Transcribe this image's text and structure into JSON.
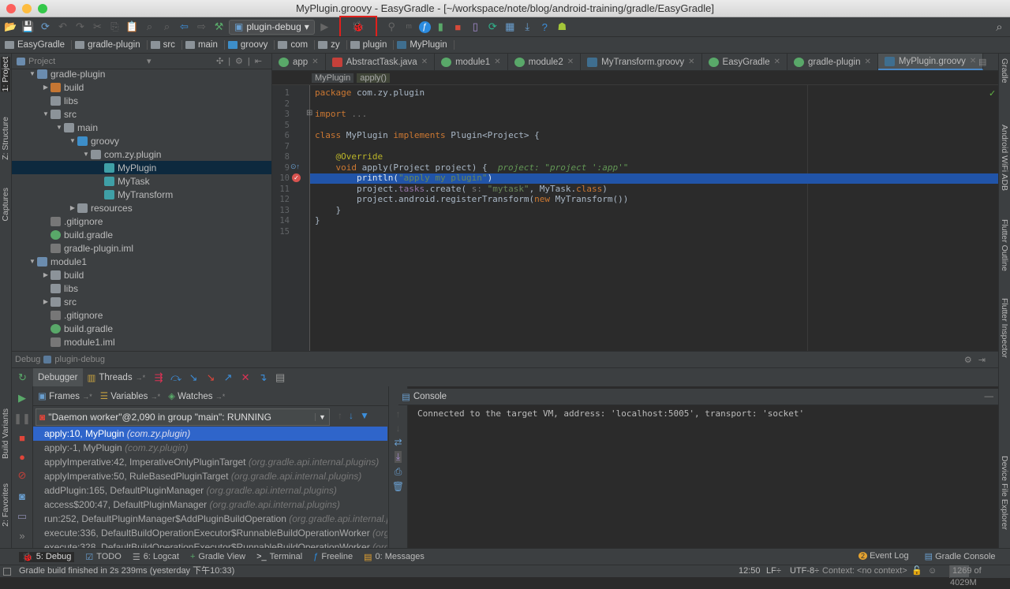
{
  "window": {
    "title": "MyPlugin.groovy - EasyGradle - [~/workspace/note/blog/android-training/gradle/EasyGradle]"
  },
  "toolbar": {
    "run_config": "plugin-debug",
    "icons": [
      "open-icon",
      "save-icon",
      "sync-icon",
      "undo-icon",
      "redo-icon",
      "cut-icon",
      "copy-icon",
      "paste-icon",
      "find-icon",
      "replace-icon",
      "back-icon",
      "forward-icon",
      "build-hammer-icon"
    ],
    "icons_right": [
      "run-icon",
      "debug-icon",
      "attach-icon",
      "profile-icon",
      "freeline-icon",
      "apply-changes-icon",
      "stop-icon",
      "avd-manager-icon",
      "gradle-sync-icon",
      "project-structure-icon",
      "sdk-manager-icon",
      "help-icon",
      "android-icon"
    ],
    "highlight_color": "#e0201c"
  },
  "breadcrumb": [
    "EasyGradle",
    "gradle-plugin",
    "src",
    "main",
    "groovy",
    "com",
    "zy",
    "plugin",
    "MyPlugin"
  ],
  "left_strip": [
    "1: Project",
    "Z: Structure",
    "Captures",
    "Build Variants",
    "2: Favorites"
  ],
  "right_strip": [
    "Gradle",
    "Android WiFi ADB",
    "Flutter Outline",
    "Flutter Inspector",
    "Device File Explorer"
  ],
  "project": {
    "header": "Project",
    "tree": [
      {
        "label": "gradle-plugin",
        "depth": 0,
        "arrow": "open",
        "type": "module"
      },
      {
        "label": "build",
        "depth": 1,
        "arrow": "closed",
        "type": "folder-orange"
      },
      {
        "label": "libs",
        "depth": 1,
        "arrow": "",
        "type": "folder"
      },
      {
        "label": "src",
        "depth": 1,
        "arrow": "open",
        "type": "folder"
      },
      {
        "label": "main",
        "depth": 2,
        "arrow": "open",
        "type": "folder"
      },
      {
        "label": "groovy",
        "depth": 3,
        "arrow": "open",
        "type": "folder-blue"
      },
      {
        "label": "com.zy.plugin",
        "depth": 4,
        "arrow": "open",
        "type": "package"
      },
      {
        "label": "MyPlugin",
        "depth": 5,
        "arrow": "",
        "type": "groovy",
        "selected": true
      },
      {
        "label": "MyTask",
        "depth": 5,
        "arrow": "",
        "type": "groovy"
      },
      {
        "label": "MyTransform",
        "depth": 5,
        "arrow": "",
        "type": "groovy"
      },
      {
        "label": "resources",
        "depth": 3,
        "arrow": "closed",
        "type": "folder"
      },
      {
        "label": ".gitignore",
        "depth": 1,
        "arrow": "",
        "type": "file"
      },
      {
        "label": "build.gradle",
        "depth": 1,
        "arrow": "",
        "type": "gradle"
      },
      {
        "label": "gradle-plugin.iml",
        "depth": 1,
        "arrow": "",
        "type": "file"
      },
      {
        "label": "module1",
        "depth": 0,
        "arrow": "open",
        "type": "module"
      },
      {
        "label": "build",
        "depth": 1,
        "arrow": "closed",
        "type": "folder"
      },
      {
        "label": "libs",
        "depth": 1,
        "arrow": "",
        "type": "folder"
      },
      {
        "label": "src",
        "depth": 1,
        "arrow": "closed",
        "type": "folder"
      },
      {
        "label": ".gitignore",
        "depth": 1,
        "arrow": "",
        "type": "file"
      },
      {
        "label": "build.gradle",
        "depth": 1,
        "arrow": "",
        "type": "gradle"
      },
      {
        "label": "module1.iml",
        "depth": 1,
        "arrow": "",
        "type": "file"
      }
    ]
  },
  "editor": {
    "tabs": [
      {
        "label": "app",
        "icon": "gradle"
      },
      {
        "label": "AbstractTask.java",
        "icon": "java"
      },
      {
        "label": "module1",
        "icon": "gradle"
      },
      {
        "label": "module2",
        "icon": "gradle"
      },
      {
        "label": "MyTransform.groovy",
        "icon": "groovy"
      },
      {
        "label": "EasyGradle",
        "icon": "gradle"
      },
      {
        "label": "gradle-plugin",
        "icon": "gradle"
      },
      {
        "label": "MyPlugin.groovy",
        "icon": "groovy",
        "active": true
      }
    ],
    "code_breadcrumb": [
      "MyPlugin",
      "apply()"
    ],
    "lines": [
      {
        "n": "1",
        "t": [
          [
            "package",
            "k"
          ],
          [
            " com.zy.plugin",
            ""
          ]
        ]
      },
      {
        "n": "2",
        "t": []
      },
      {
        "n": "3",
        "t": [
          [
            "import",
            "k"
          ],
          [
            " ...",
            "h"
          ]
        ]
      },
      {
        "n": "5",
        "t": []
      },
      {
        "n": "6",
        "t": [
          [
            "class",
            "k"
          ],
          [
            " MyPlugin ",
            ""
          ],
          [
            "implements",
            "k"
          ],
          [
            " Plugin<Project> {",
            ""
          ]
        ]
      },
      {
        "n": "7",
        "t": []
      },
      {
        "n": "8",
        "t": [
          [
            "    @Override",
            "a"
          ]
        ]
      },
      {
        "n": "9",
        "t": [
          [
            "    ",
            ""
          ],
          [
            "void",
            "k"
          ],
          [
            " apply(Project project) {  ",
            ""
          ],
          [
            "project: \"project ':app'\"",
            "p"
          ]
        ]
      },
      {
        "n": "10",
        "t": [
          [
            "        println(",
            ""
          ],
          [
            "\"apply my plugin\"",
            "s"
          ],
          [
            ")",
            ""
          ]
        ],
        "current": true
      },
      {
        "n": "11",
        "t": [
          [
            "        project.",
            ""
          ],
          [
            "tasks",
            "f"
          ],
          [
            ".create( ",
            ""
          ],
          [
            "s: ",
            "h"
          ],
          [
            "\"mytask\"",
            "s"
          ],
          [
            ", MyTask.",
            ""
          ],
          [
            "class",
            "k"
          ],
          [
            ")",
            ""
          ]
        ]
      },
      {
        "n": "12",
        "t": [
          [
            "        project.android.registerTransform(",
            ""
          ],
          [
            "new",
            "k"
          ],
          [
            " MyTransform())",
            ""
          ]
        ]
      },
      {
        "n": "13",
        "t": [
          [
            "    }",
            ""
          ]
        ]
      },
      {
        "n": "14",
        "t": [
          [
            "}",
            ""
          ]
        ]
      },
      {
        "n": "15",
        "t": []
      }
    ]
  },
  "debug": {
    "title": "Debug",
    "config": "plugin-debug",
    "tabs": {
      "debugger": "Debugger",
      "threads": "Threads"
    },
    "subtabs": {
      "frames": "Frames",
      "variables": "Variables",
      "watches": "Watches",
      "console": "Console"
    },
    "thread": "\"Daemon worker\"@2,090 in group \"main\": RUNNING",
    "frames": [
      {
        "m": "apply:10, MyPlugin",
        "p": "(com.zy.plugin)",
        "selected": true
      },
      {
        "m": "apply:-1, MyPlugin",
        "p": "(com.zy.plugin)"
      },
      {
        "m": "applyImperative:42, ImperativeOnlyPluginTarget",
        "p": "(org.gradle.api.internal.plugins)"
      },
      {
        "m": "applyImperative:50, RuleBasedPluginTarget",
        "p": "(org.gradle.api.internal.plugins)"
      },
      {
        "m": "addPlugin:165, DefaultPluginManager",
        "p": "(org.gradle.api.internal.plugins)"
      },
      {
        "m": "access$200:47, DefaultPluginManager",
        "p": "(org.gradle.api.internal.plugins)"
      },
      {
        "m": "run:252, DefaultPluginManager$AddPluginBuildOperation",
        "p": "(org.gradle.api.internal.plugins)"
      },
      {
        "m": "execute:336, DefaultBuildOperationExecutor$RunnableBuildOperationWorker",
        "p": "(org.gradle.internal.operations)"
      },
      {
        "m": "execute:328, DefaultBuildOperationExecutor$RunnableBuildOperationWorker",
        "p": "(org.gradle.internal.operations)"
      }
    ],
    "console_text": "Connected to the target VM, address: 'localhost:5005', transport: 'socket'"
  },
  "bottom_tabs": [
    {
      "label": "5: Debug",
      "icon": "bug-icon"
    },
    {
      "label": "TODO",
      "icon": "todo-icon"
    },
    {
      "label": "6: Logcat",
      "icon": "logcat-icon"
    },
    {
      "label": "Gradle View",
      "icon": "plus-icon"
    },
    {
      "label": "Terminal",
      "icon": "terminal-icon"
    },
    {
      "label": "Freeline",
      "icon": "freeline-icon"
    },
    {
      "label": "0: Messages",
      "icon": "messages-icon"
    }
  ],
  "bottom_right": {
    "event_log": "Event Log",
    "event_count": "2",
    "gradle_console": "Gradle Console"
  },
  "status": {
    "message": "Gradle build finished in 2s 239ms (yesterday 下午10:33)",
    "position": "12:50",
    "line_sep": "LF÷",
    "encoding": "UTF-8÷",
    "context": "Context: <no context>",
    "memory": "1269 of 4029M",
    "memory_used_fraction": 0.315
  }
}
